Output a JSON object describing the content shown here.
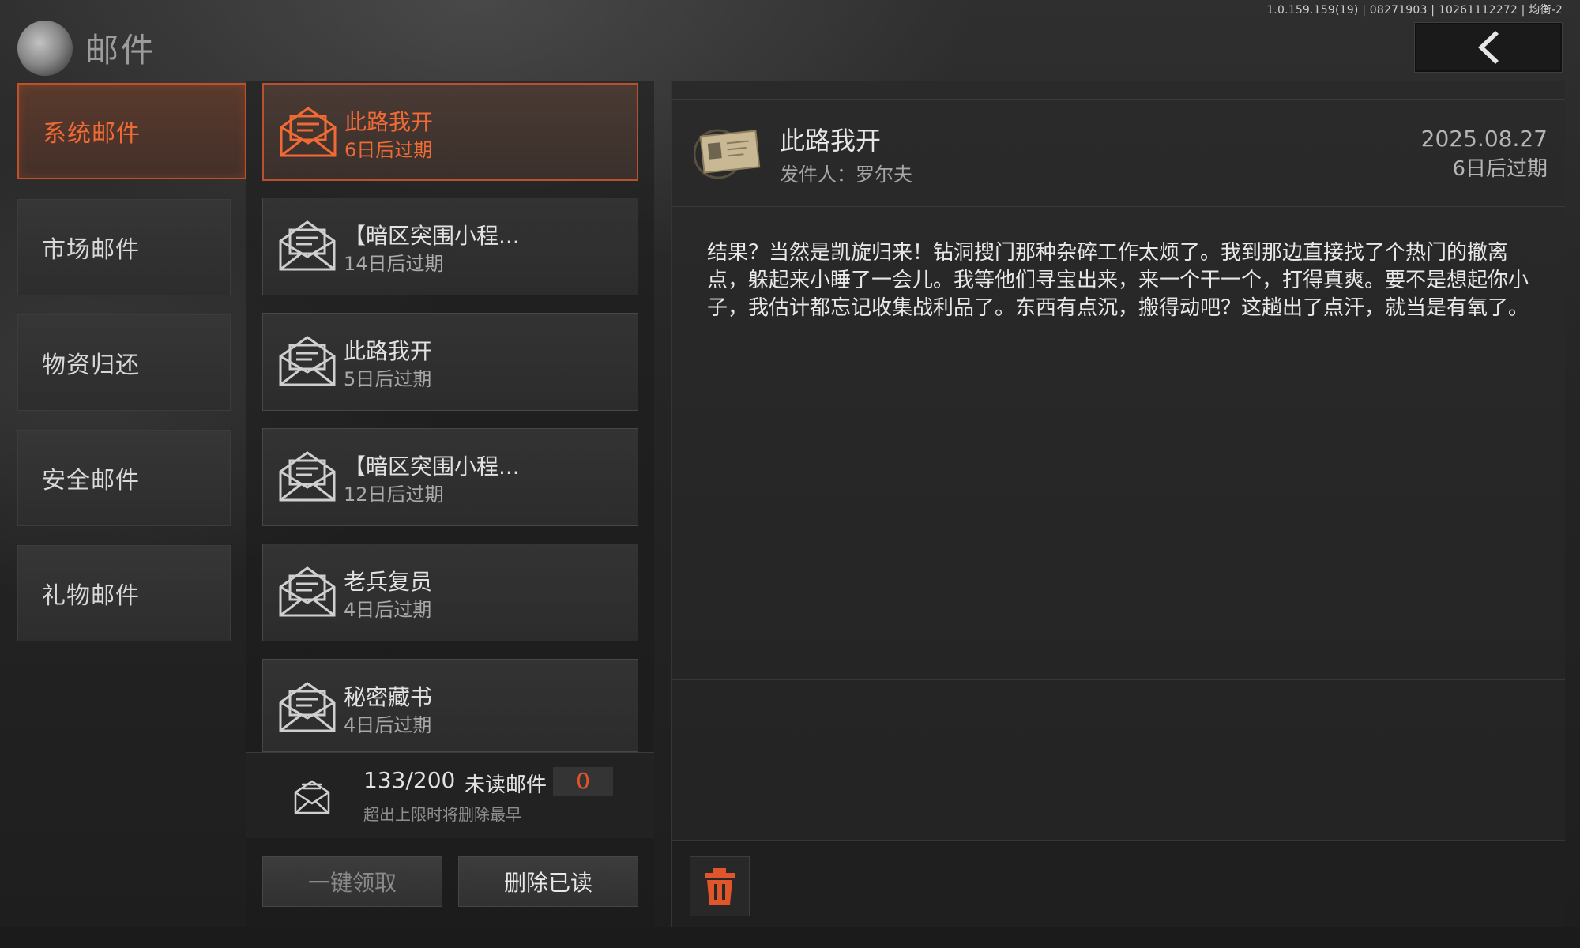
{
  "version": "1.0.159.159(19) | 08271903 | 10261112272 | 均衡-2",
  "header": {
    "title": "邮件"
  },
  "categories": [
    {
      "label": "系统邮件"
    },
    {
      "label": "市场邮件"
    },
    {
      "label": "物资归还"
    },
    {
      "label": "安全邮件"
    },
    {
      "label": "礼物邮件"
    }
  ],
  "mails": [
    {
      "title": "此路我开",
      "expire": "6日后过期"
    },
    {
      "title": "【暗区突围小程...",
      "expire": "14日后过期"
    },
    {
      "title": "此路我开",
      "expire": "5日后过期"
    },
    {
      "title": "【暗区突围小程...",
      "expire": "12日后过期"
    },
    {
      "title": "老兵复员",
      "expire": "4日后过期"
    },
    {
      "title": "秘密藏书",
      "expire": "4日后过期"
    }
  ],
  "footer": {
    "count": "133/200",
    "unread_label": "未读邮件",
    "unread_count": "0",
    "limit_note": "超出上限时将删除最早"
  },
  "buttons": {
    "claim_all": "一键领取",
    "delete_read": "删除已读"
  },
  "detail": {
    "title": "此路我开",
    "sender": "发件人：罗尔夫",
    "date": "2025.08.27",
    "expire": "6日后过期",
    "body": "结果？当然是凯旋归来！钻洞搜门那种杂碎工作太烦了。我到那边直接找了个热门的撤离点，躲起来小睡了一会儿。我等他们寻宝出来，来一个干一个，打得真爽。要不是想起你小子，我估计都忘记收集战利品了。东西有点沉，搬得动吧？这趟出了点汗，就当是有氧了。"
  },
  "colors": {
    "accent": "#f06a35",
    "accent_border": "#c0502c",
    "trash": "#e1552b"
  }
}
